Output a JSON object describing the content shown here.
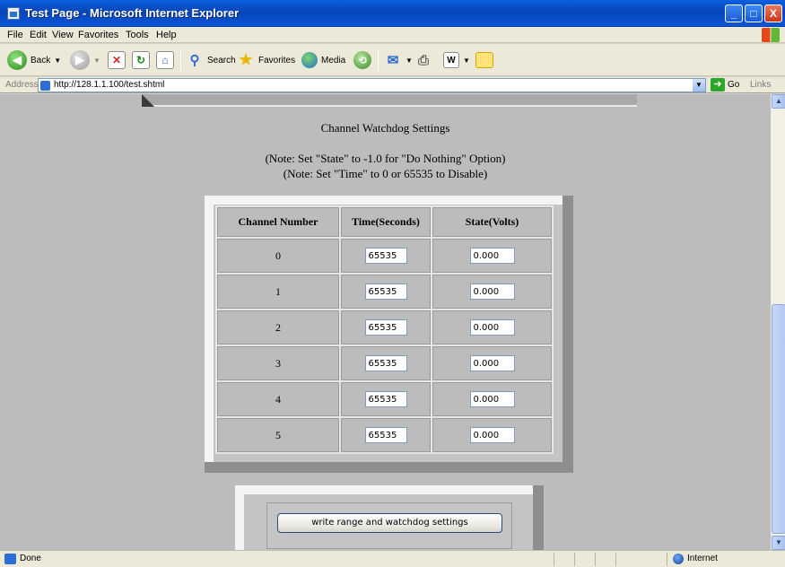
{
  "window": {
    "title": "Test Page - Microsoft Internet Explorer",
    "min_glyph": "_",
    "max_glyph": "□",
    "close_glyph": "X"
  },
  "menu": [
    "File",
    "Edit",
    "View",
    "Favorites",
    "Tools",
    "Help"
  ],
  "toolbar": {
    "back_label": "Back",
    "search_label": "Search",
    "favorites_label": "Favorites",
    "media_label": "Media"
  },
  "address": {
    "label": "Address",
    "url": "http://128.1.1.100/test.shtml",
    "go_label": "Go",
    "links_label": "Links"
  },
  "page": {
    "heading": "Channel Watchdog Settings",
    "note1": "(Note: Set \"State\" to -1.0 for \"Do Nothing\" Option)",
    "note2": "(Note: Set \"Time\" to 0 or 65535 to Disable)",
    "table": {
      "headers": [
        "Channel Number",
        "Time(Seconds)",
        "State(Volts)"
      ],
      "rows": [
        {
          "channel": "0",
          "time": "65535",
          "state": "0.000"
        },
        {
          "channel": "1",
          "time": "65535",
          "state": "0.000"
        },
        {
          "channel": "2",
          "time": "65535",
          "state": "0.000"
        },
        {
          "channel": "3",
          "time": "65535",
          "state": "0.000"
        },
        {
          "channel": "4",
          "time": "65535",
          "state": "0.000"
        },
        {
          "channel": "5",
          "time": "65535",
          "state": "0.000"
        }
      ]
    },
    "submit_label": "write range and watchdog settings"
  },
  "status": {
    "text": "Done",
    "zone": "Internet"
  },
  "colors": {
    "titlebar": "#0845b8",
    "page_background": "#bcbcbc",
    "chrome": "#ece9d8"
  }
}
